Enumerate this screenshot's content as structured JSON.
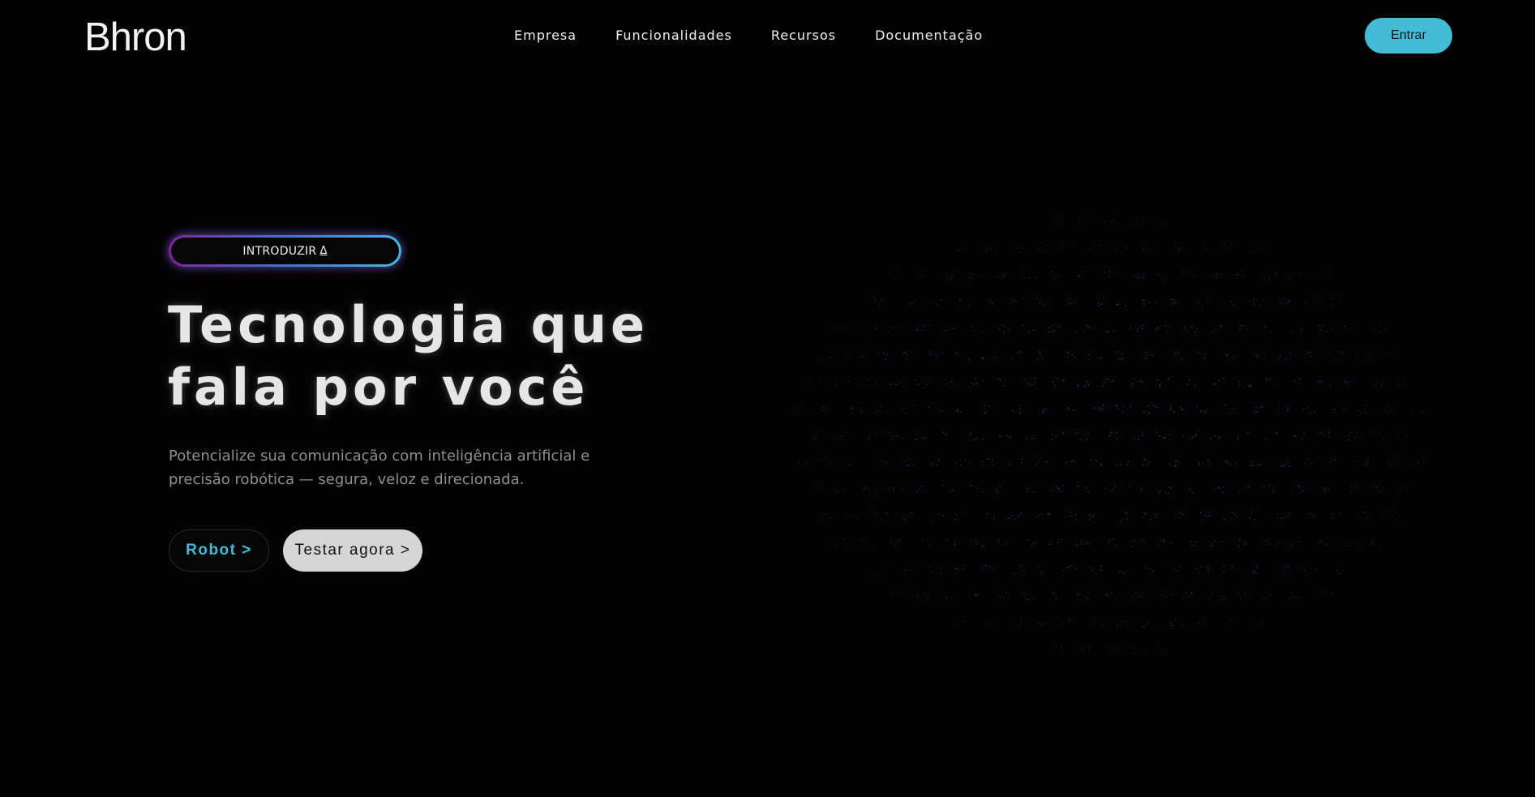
{
  "header": {
    "logo": "Bhron",
    "nav": [
      {
        "label": "Empresa"
      },
      {
        "label": "Funcionalidades"
      },
      {
        "label": "Recursos"
      },
      {
        "label": "Documentação"
      }
    ],
    "login_label": "Entrar"
  },
  "hero": {
    "badge_label": "INTRODUZIR",
    "badge_icon": "Δ",
    "headline_line1": "Tecnologia que",
    "headline_line2": "fala por você",
    "subtitle_line1": "Potencialize sua comunicação com inteligência artificial e",
    "subtitle_line2": "precisão robótica — segura, veloz e direcionada.",
    "robot_button": "Robot >",
    "try_button": "Testar agora >"
  },
  "colors": {
    "background": "#030303",
    "accent": "#45bcd6",
    "badge_gradient_start": "#8a1ea8",
    "badge_gradient_end": "#47b6e0",
    "secondary_button": "#d6d6d6"
  },
  "icons": {
    "badge_icon": "delta-icon",
    "globe": "particle-globe-graphic"
  }
}
